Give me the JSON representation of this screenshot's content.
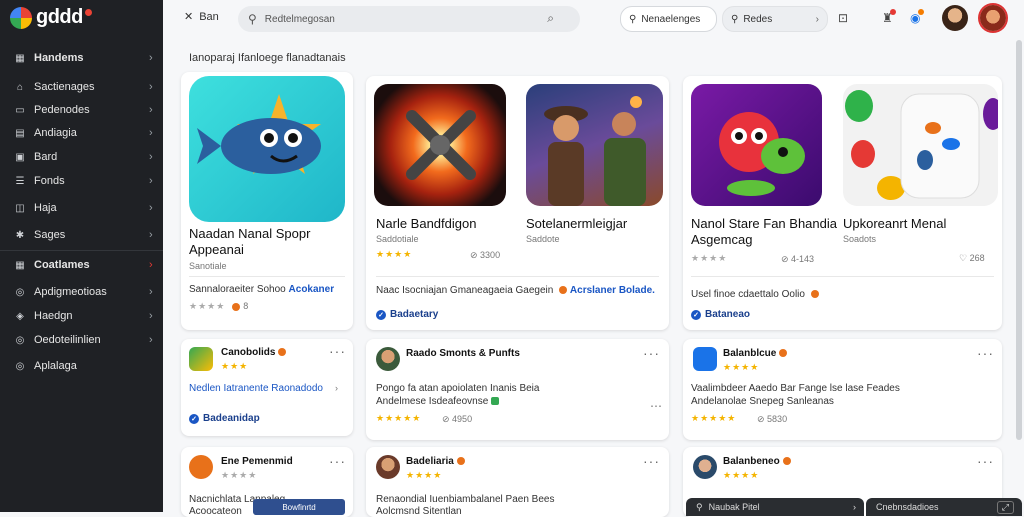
{
  "app": {
    "logo_text": "gddd"
  },
  "sidebar": {
    "items": [
      {
        "label": "Handems",
        "icon": "grid-icon",
        "bold": true
      },
      {
        "label": "Sactienages",
        "icon": "home-icon"
      },
      {
        "label": "Pedenodes",
        "icon": "folder-icon"
      },
      {
        "label": "Andiagia",
        "icon": "calendar-icon"
      },
      {
        "label": "Bard",
        "icon": "card-icon"
      },
      {
        "label": "Fonds",
        "icon": "list-icon"
      },
      {
        "label": "Haja",
        "icon": "box-icon"
      },
      {
        "label": "Sages",
        "icon": "gear-icon"
      },
      {
        "label": "Coatlames",
        "icon": "grid-icon",
        "bold": true
      },
      {
        "label": "Apdigmeotioas",
        "icon": "globe-icon"
      },
      {
        "label": "Haedgn",
        "icon": "shield-icon"
      },
      {
        "label": "Oedoteilinlien",
        "icon": "globe-icon"
      },
      {
        "label": "Aplalaga",
        "icon": "globe-icon"
      }
    ]
  },
  "topbar": {
    "back_label": "Ban",
    "search_placeholder": "Redtelmegosan",
    "pill1_label": "Nenaelenges",
    "pill2_label": "Redes"
  },
  "section": {
    "title": "Ianoparaj Ifanloege flanadtanais"
  },
  "featured": [
    {
      "name": "Naadan Nanal Spopr Appeanai",
      "sub": "Sanotiale",
      "meta": "",
      "desc": "Sannaloraeiter Sohoo",
      "link": "Acokaner",
      "verified": ""
    },
    {
      "name": "Narle Bandfdigon",
      "sub": "Saddotiale",
      "meta": "3300",
      "desc": "Naac Isocniajan Gmaneagaeia Gaegein",
      "link": "Acrslaner Bolade.",
      "verified": "Badaetary"
    },
    {
      "name": "Sotelanermleigjar",
      "sub": "Saddote",
      "meta": "",
      "desc": "",
      "link": "",
      "verified": ""
    },
    {
      "name": "Nanol Stare Fan Bhandia Asgemcag",
      "sub": "",
      "meta": "4-143",
      "desc": "Usel finoe cdaettalo Oolio",
      "link": "",
      "verified": "Bataneao"
    },
    {
      "name": "Upkoreanrt Menal",
      "sub": "Soadots",
      "meta": "268",
      "desc": "",
      "link": "",
      "verified": ""
    }
  ],
  "small_cards": [
    {
      "title": "Canobolids",
      "desc": "Nedlen Iatranente Raonadodo",
      "verified": "Badeanidap"
    },
    {
      "title": "Raado Smonts & Punfts",
      "desc": "Pongo fa atan apoiolaten Inanis Beia",
      "desc2": "Andelmese Isdeafeovnse",
      "meta": "4950"
    },
    {
      "title": "Balanblcue",
      "desc": "Vaalimbdeer Aaedo Bar Fange lse lase Feades",
      "desc2": "Andelanolae Snepeg Sanleanas",
      "meta": "5830"
    },
    {
      "title": "Ene Pemenmid",
      "desc": "Nacnichlata Lanpaleg",
      "desc2": "Acoocateon",
      "button": "Bowfinrtd"
    },
    {
      "title": "Badeliaria",
      "desc": "Renaondial Iuenbiambalanel Paen Bees",
      "desc2": "Aolcmsnd Sitentlan"
    },
    {
      "title": "Balanbeneo",
      "desc": "",
      "desc2": ""
    }
  ],
  "bottom_bars": [
    {
      "label": "Naubak Pitel"
    },
    {
      "label": "Cnebnsdadioes"
    }
  ]
}
